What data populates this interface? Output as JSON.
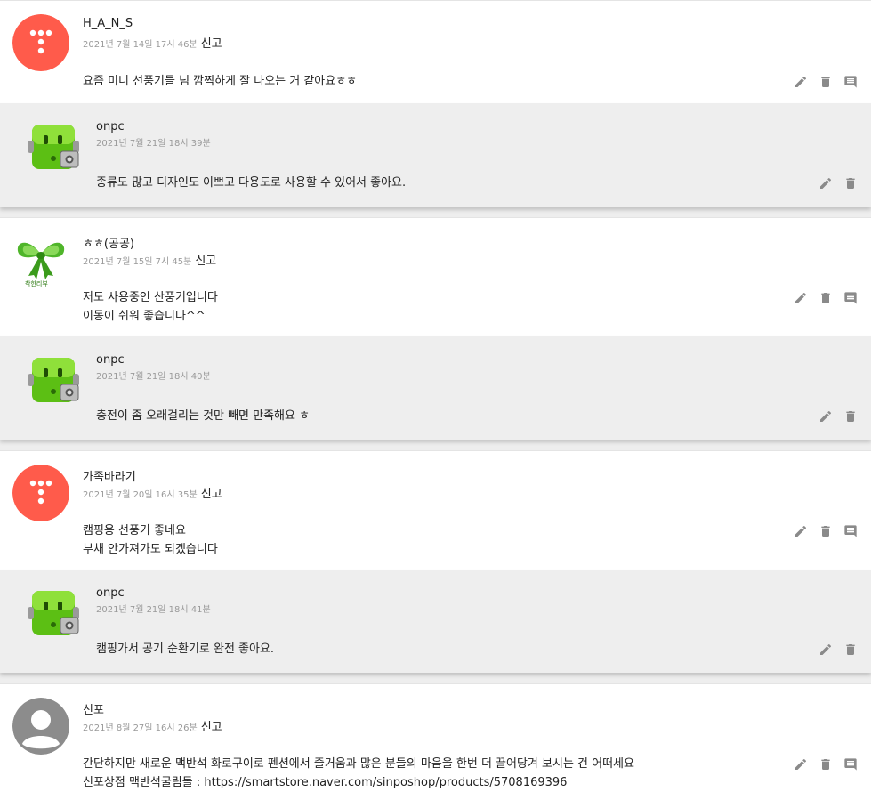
{
  "comments": [
    {
      "author": "H_A_N_S",
      "date": "2021년 7월 14일 17시 46분",
      "report": "신고",
      "lines": [
        "요즘 미니 선풍기들 넘 깜찍하게 잘 나오는 거 같아요ㅎㅎ"
      ],
      "avatar_icon": "tistory-logo-icon",
      "avatar_color": "#ff5b4b",
      "reply": {
        "author": "onpc",
        "date": "2021년 7월 21일 18시 39분",
        "lines": [
          "종류도 많고 디자인도 이쁘고 다용도로 사용할 수 있어서 좋아요."
        ],
        "avatar_icon": "green-robot-icon"
      }
    },
    {
      "author": "ㅎㅎ(공공)",
      "date": "2021년 7월 15일 7시 45분",
      "report": "신고",
      "lines": [
        "저도 사용중인 산풍기입니다",
        "이동이 쉬워 좋습니다^^"
      ],
      "avatar_icon": "green-ribbon-icon",
      "avatar_caption": "착한리뷰",
      "reply": {
        "author": "onpc",
        "date": "2021년 7월 21일 18시 40분",
        "lines": [
          "충전이 좀 오래걸리는 것만 빼면 만족해요 ㅎ"
        ],
        "avatar_icon": "green-robot-icon"
      }
    },
    {
      "author": "가족바라기",
      "date": "2021년 7월 20일 16시 35분",
      "report": "신고",
      "lines": [
        "캠핑용 선풍기 좋네요",
        "부채 안가져가도 되겠습니다"
      ],
      "avatar_icon": "tistory-logo-icon",
      "avatar_color": "#ff5b4b",
      "reply": {
        "author": "onpc",
        "date": "2021년 7월 21일 18시 41분",
        "lines": [
          "캠핑가서 공기 순환기로 완전 좋아요."
        ],
        "avatar_icon": "green-robot-icon"
      }
    },
    {
      "author": "신포",
      "date": "2021년 8월 27일 16시 26분",
      "report": "신고",
      "lines": [
        "간단하지만 새로운 맥반석 화로구이로 펜션에서 즐거움과 많은 분들의 마음을 한번 더 끌어당겨 보시는 건 어떠세요",
        "신포상점 맥반석굴림돌 : https://smartstore.naver.com/sinposhop/products/5708169396"
      ],
      "avatar_icon": "default-user-icon",
      "avatar_color": "#8c8c8c"
    }
  ],
  "icons": {
    "edit": "pencil-icon",
    "delete": "trash-icon",
    "reply": "comment-icon"
  },
  "colors": {
    "icon": "#8a8a8a",
    "reply_bg": "#eeeeee",
    "meta": "#9a9a9a"
  }
}
